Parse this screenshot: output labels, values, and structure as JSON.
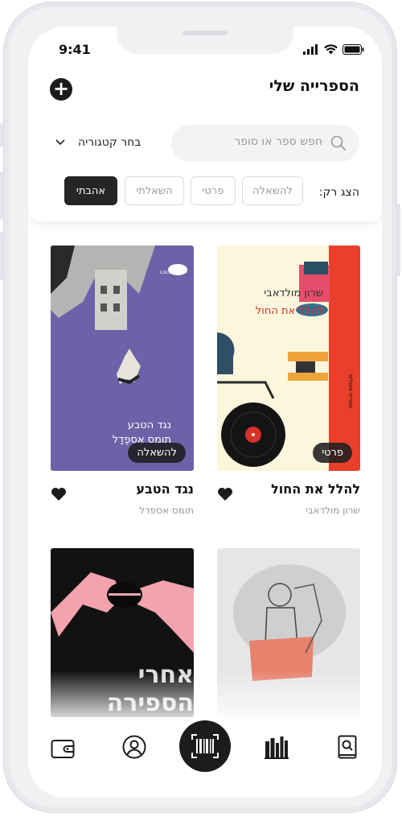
{
  "status": {
    "time": "9:41"
  },
  "header": {
    "title": "הספרייה שלי",
    "search_placeholder": "חפש ספר או סופר",
    "category_label": "בחר קטגוריה",
    "show_only_label": "הצג רק:",
    "filters": [
      "להשאלה",
      "פרטי",
      "השאלתי",
      "אהבתי"
    ],
    "active_filter": "אהבתי"
  },
  "books": [
    {
      "title": "להלל את החול",
      "author": "שרון מולדאבי",
      "badge": "פרטי",
      "cover": {
        "author": "שרון מולדאבי",
        "title": "להלל את החול",
        "publisher": "ספרית פועלים"
      }
    },
    {
      "title": "נגד הטבע",
      "author": "תומס אספדל",
      "badge": "להשאלה",
      "cover": {
        "title": "נגד הטבע",
        "author": "תומס אֶספֶדַל",
        "publisher": "Locus לוקוס"
      }
    },
    {
      "cover_text": "אחרי הספירה"
    },
    {}
  ],
  "colors": {
    "accent": "#1c1c1c",
    "purple_cover": "#6c62a8",
    "red_spine": "#e8402a"
  },
  "tabbar": {
    "icons": [
      "wallet-icon",
      "user-icon",
      "barcode-scan-icon",
      "library-icon",
      "book-search-icon"
    ]
  }
}
